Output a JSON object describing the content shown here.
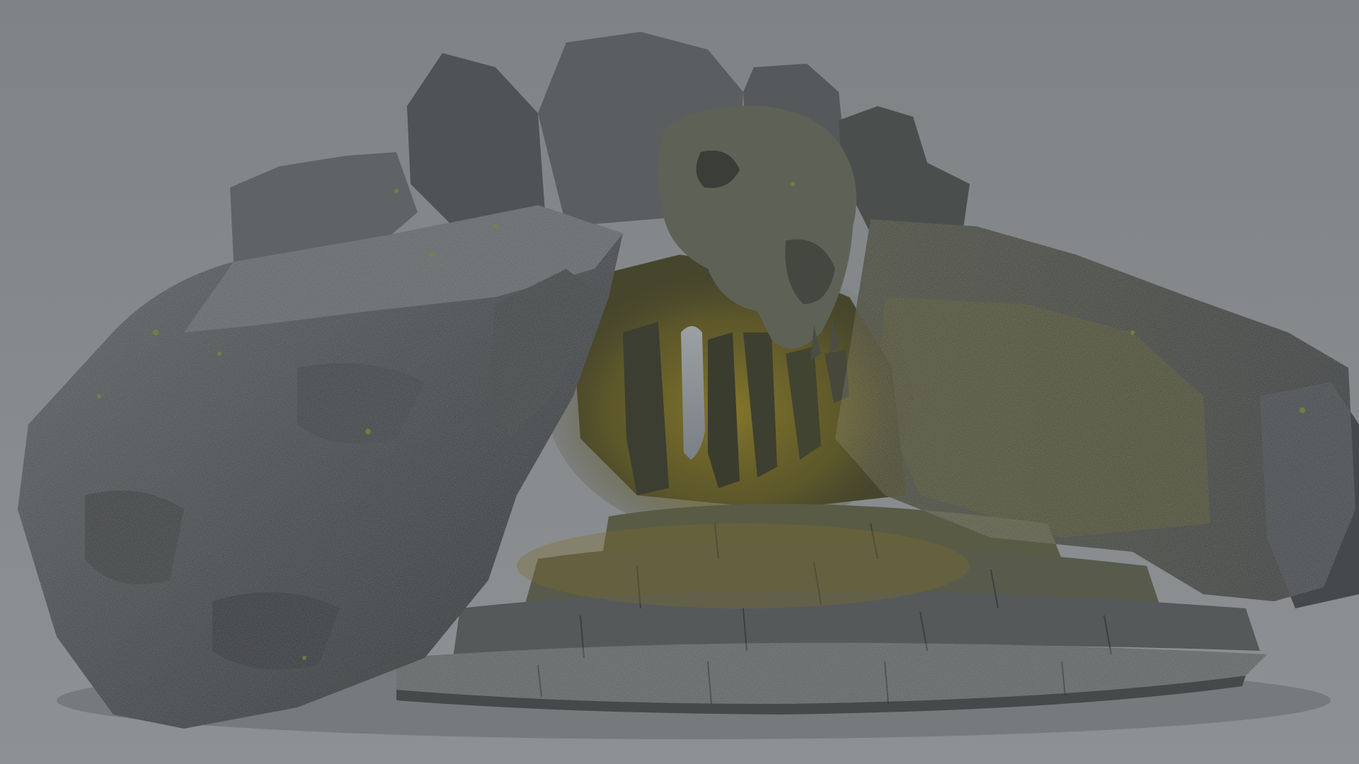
{
  "scene": {
    "subject": "cave-entrance-rock-model",
    "colors": {
      "background_top": "#7f8386",
      "background_bottom": "#8c9093",
      "rock_dark": "#2e3133",
      "rock_mid": "#4b4f51",
      "rock_light": "#6e7274",
      "moss_yellow": "#8a7b2c",
      "moss_green": "#5f7a33",
      "stone_step": "#565a5a",
      "opening_light": "#8a9094"
    }
  }
}
